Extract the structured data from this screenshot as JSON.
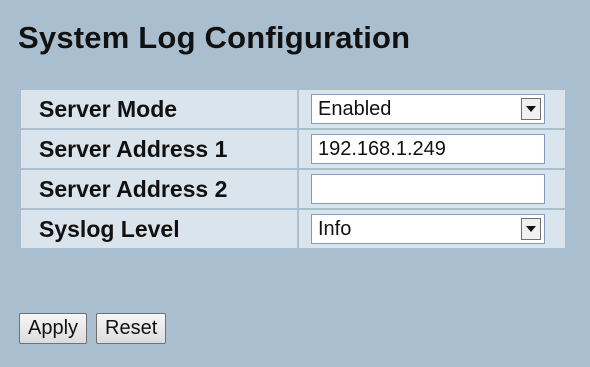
{
  "page": {
    "title": "System Log Configuration"
  },
  "form": {
    "rows": [
      {
        "label": "Server Mode",
        "type": "select",
        "value": "Enabled"
      },
      {
        "label": "Server Address 1",
        "type": "text",
        "value": "192.168.1.249"
      },
      {
        "label": "Server Address 2",
        "type": "text",
        "value": ""
      },
      {
        "label": "Syslog Level",
        "type": "select",
        "value": "Info"
      }
    ]
  },
  "buttons": {
    "apply_label": "Apply",
    "reset_label": "Reset"
  },
  "icons": {
    "dropdown": "chevron-down-icon"
  }
}
